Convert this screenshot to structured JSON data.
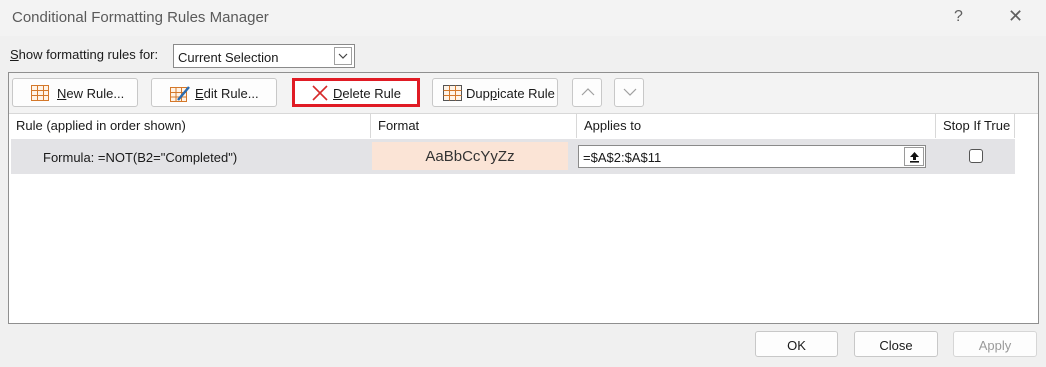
{
  "window": {
    "title": "Conditional Formatting Rules Manager",
    "help": "?",
    "close": "✕"
  },
  "show_rules": {
    "label": "Show formatting rules for:",
    "selected": "Current Selection"
  },
  "toolbar": {
    "new_rule": "New Rule...",
    "edit_rule": "Edit Rule...",
    "delete_rule": "Delete Rule",
    "duplicate_rule": "Duplicate Rule"
  },
  "columns": {
    "rule": "Rule (applied in order shown)",
    "format": "Format",
    "applies_to": "Applies to",
    "stop_if_true": "Stop If True"
  },
  "rules": [
    {
      "formula": "Formula: =NOT(B2=\"Completed\")",
      "format_preview": "AaBbCcYyZz",
      "applies_to": "=$A$2:$A$11",
      "stop_if_true": false
    }
  ],
  "footer": {
    "ok": "OK",
    "close": "Close",
    "apply": "Apply"
  },
  "colors": {
    "highlight_border": "#e01b24",
    "format_fill": "#fbe4d6",
    "selected_row": "#e3e3e6"
  }
}
